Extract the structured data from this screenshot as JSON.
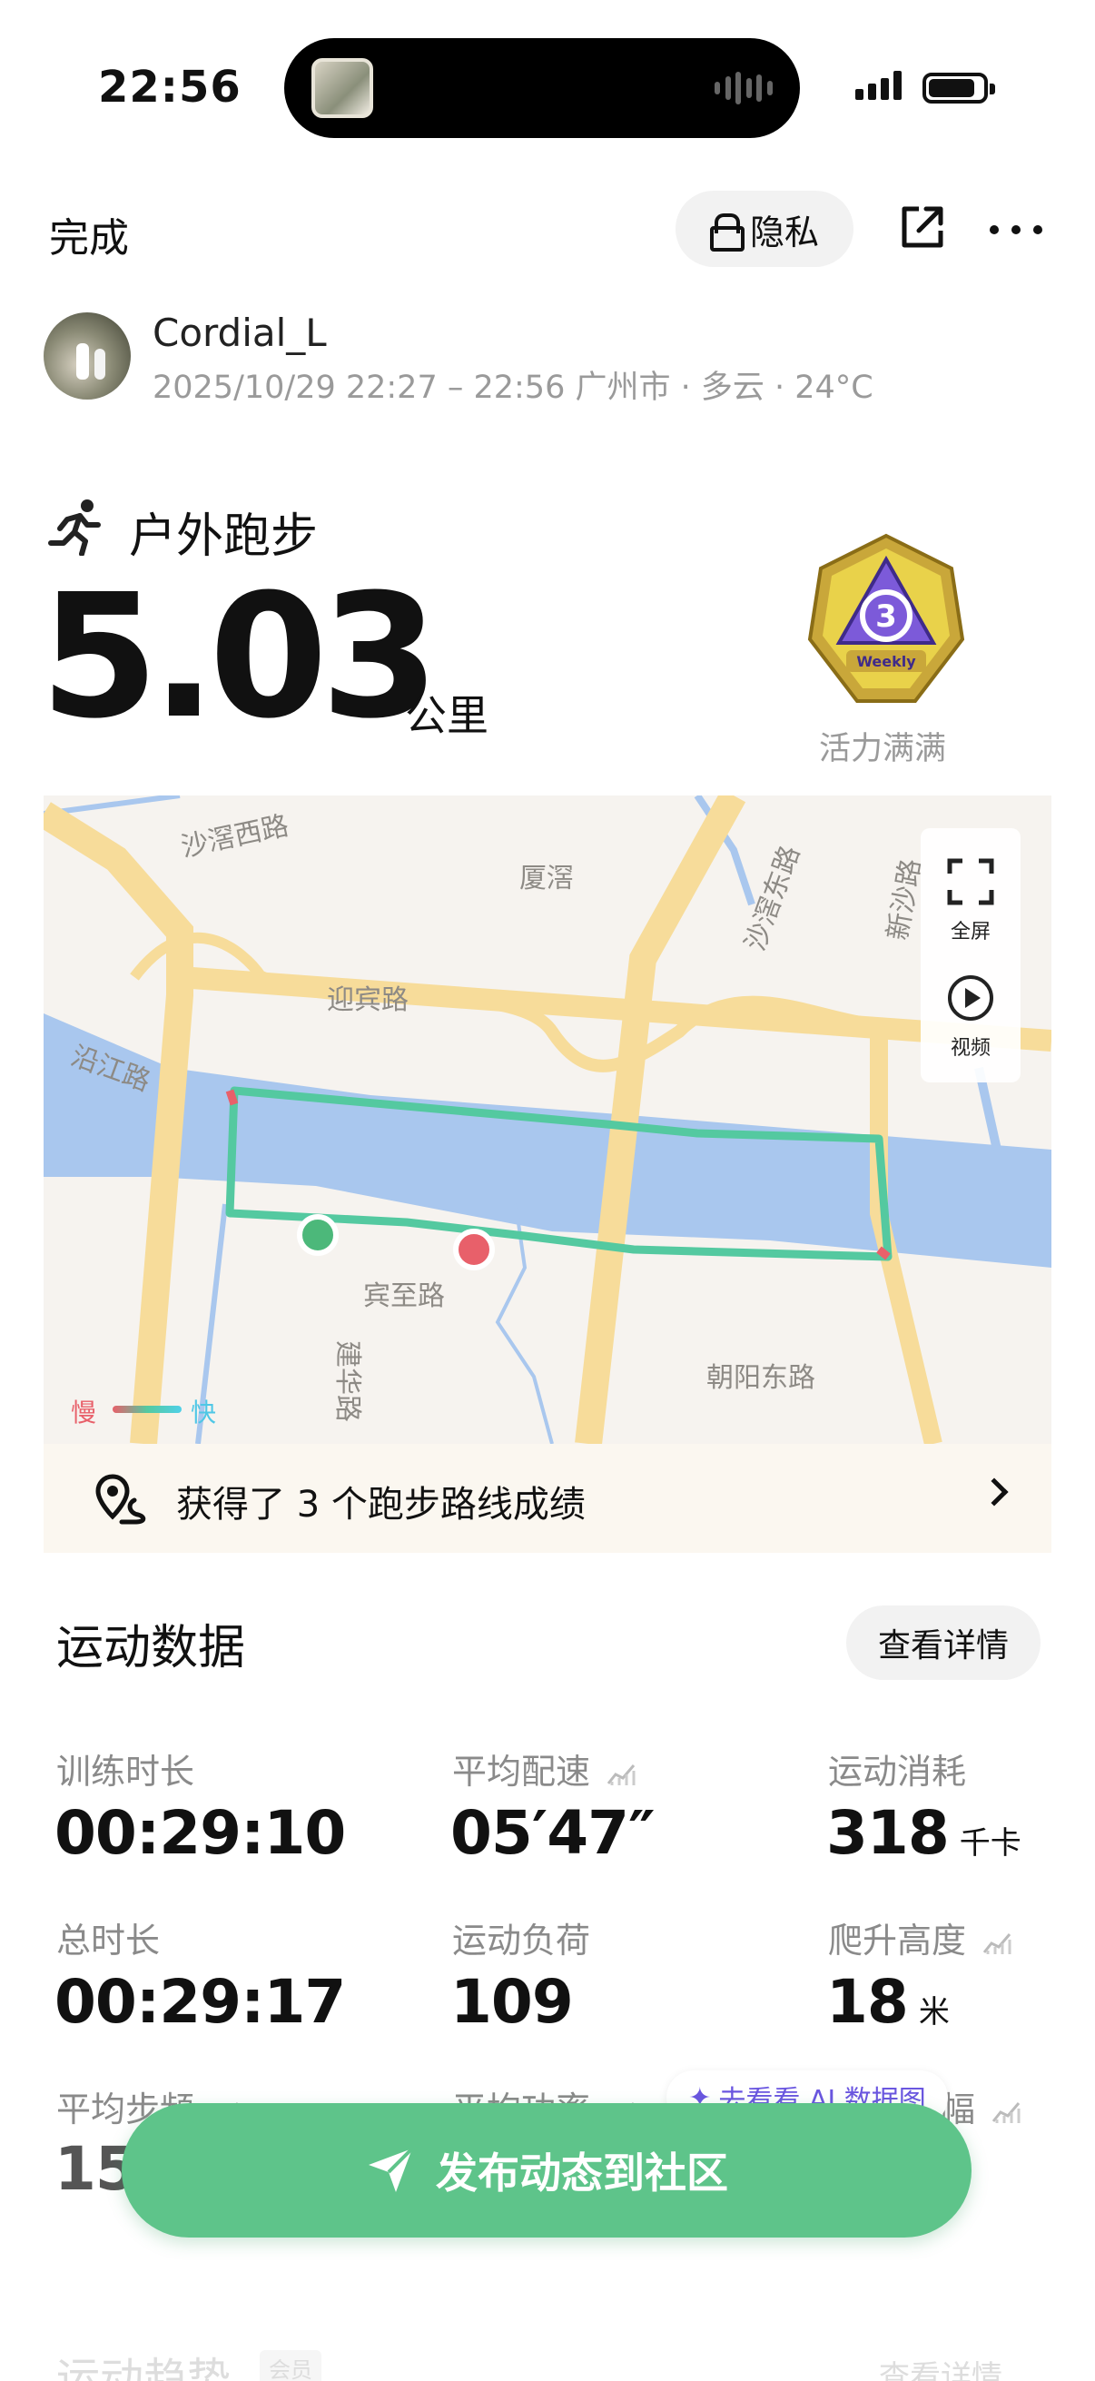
{
  "status_bar": {
    "time": "22:56"
  },
  "header": {
    "done_label": "完成",
    "privacy_label": "隐私"
  },
  "user": {
    "name": "Cordial_L",
    "meta": "2025/10/29 22:27 – 22:56 广州市 · 多云 · 24°C"
  },
  "workout": {
    "type": "户外跑步",
    "distance": "5.03",
    "unit": "公里",
    "badge_text": "Weekly",
    "badge_label": "活力满满"
  },
  "map": {
    "labels": {
      "shaxi_west": "沙滘西路",
      "xiaxi": "厦滘",
      "shaxi_east": "沙滘东路",
      "xinsha": "新沙路",
      "yingbin": "迎宾路",
      "yanjiang": "沿江路",
      "binzhi": "宾至路",
      "jianhua": "建华路",
      "chaoyang_east": "朝阳东路"
    },
    "fullscreen_label": "全屏",
    "video_label": "视频",
    "slow_label": "慢",
    "fast_label": "快"
  },
  "route_achievement": {
    "text": "获得了 3 个跑步路线成绩"
  },
  "stats": {
    "title": "运动数据",
    "details_label": "查看详情",
    "items": [
      {
        "label": "训练时长",
        "value": "00:29:10",
        "unit": ""
      },
      {
        "label": "平均配速",
        "value": "05′47″",
        "unit": ""
      },
      {
        "label": "运动消耗",
        "value": "318",
        "unit": "千卡"
      },
      {
        "label": "总时长",
        "value": "00:29:17",
        "unit": ""
      },
      {
        "label": "运动负荷",
        "value": "109",
        "unit": ""
      },
      {
        "label": "爬升高度",
        "value": "18",
        "unit": "米"
      },
      {
        "label": "平均步频",
        "value": "153",
        "unit": ""
      },
      {
        "label": "平均功率",
        "value": "",
        "unit": ""
      },
      {
        "label": "幅",
        "value": "",
        "unit": ""
      }
    ]
  },
  "ai_chip": {
    "label": "去看看 AI 数据图"
  },
  "publish_button": {
    "label": "发布动态到社区"
  },
  "trend": {
    "title": "运动趋势",
    "tag": "会员",
    "details_label": "查看详情"
  },
  "colors": {
    "accent_green": "#5ec48a",
    "route_start": "#4cb87a",
    "route_end": "#e8606a"
  }
}
